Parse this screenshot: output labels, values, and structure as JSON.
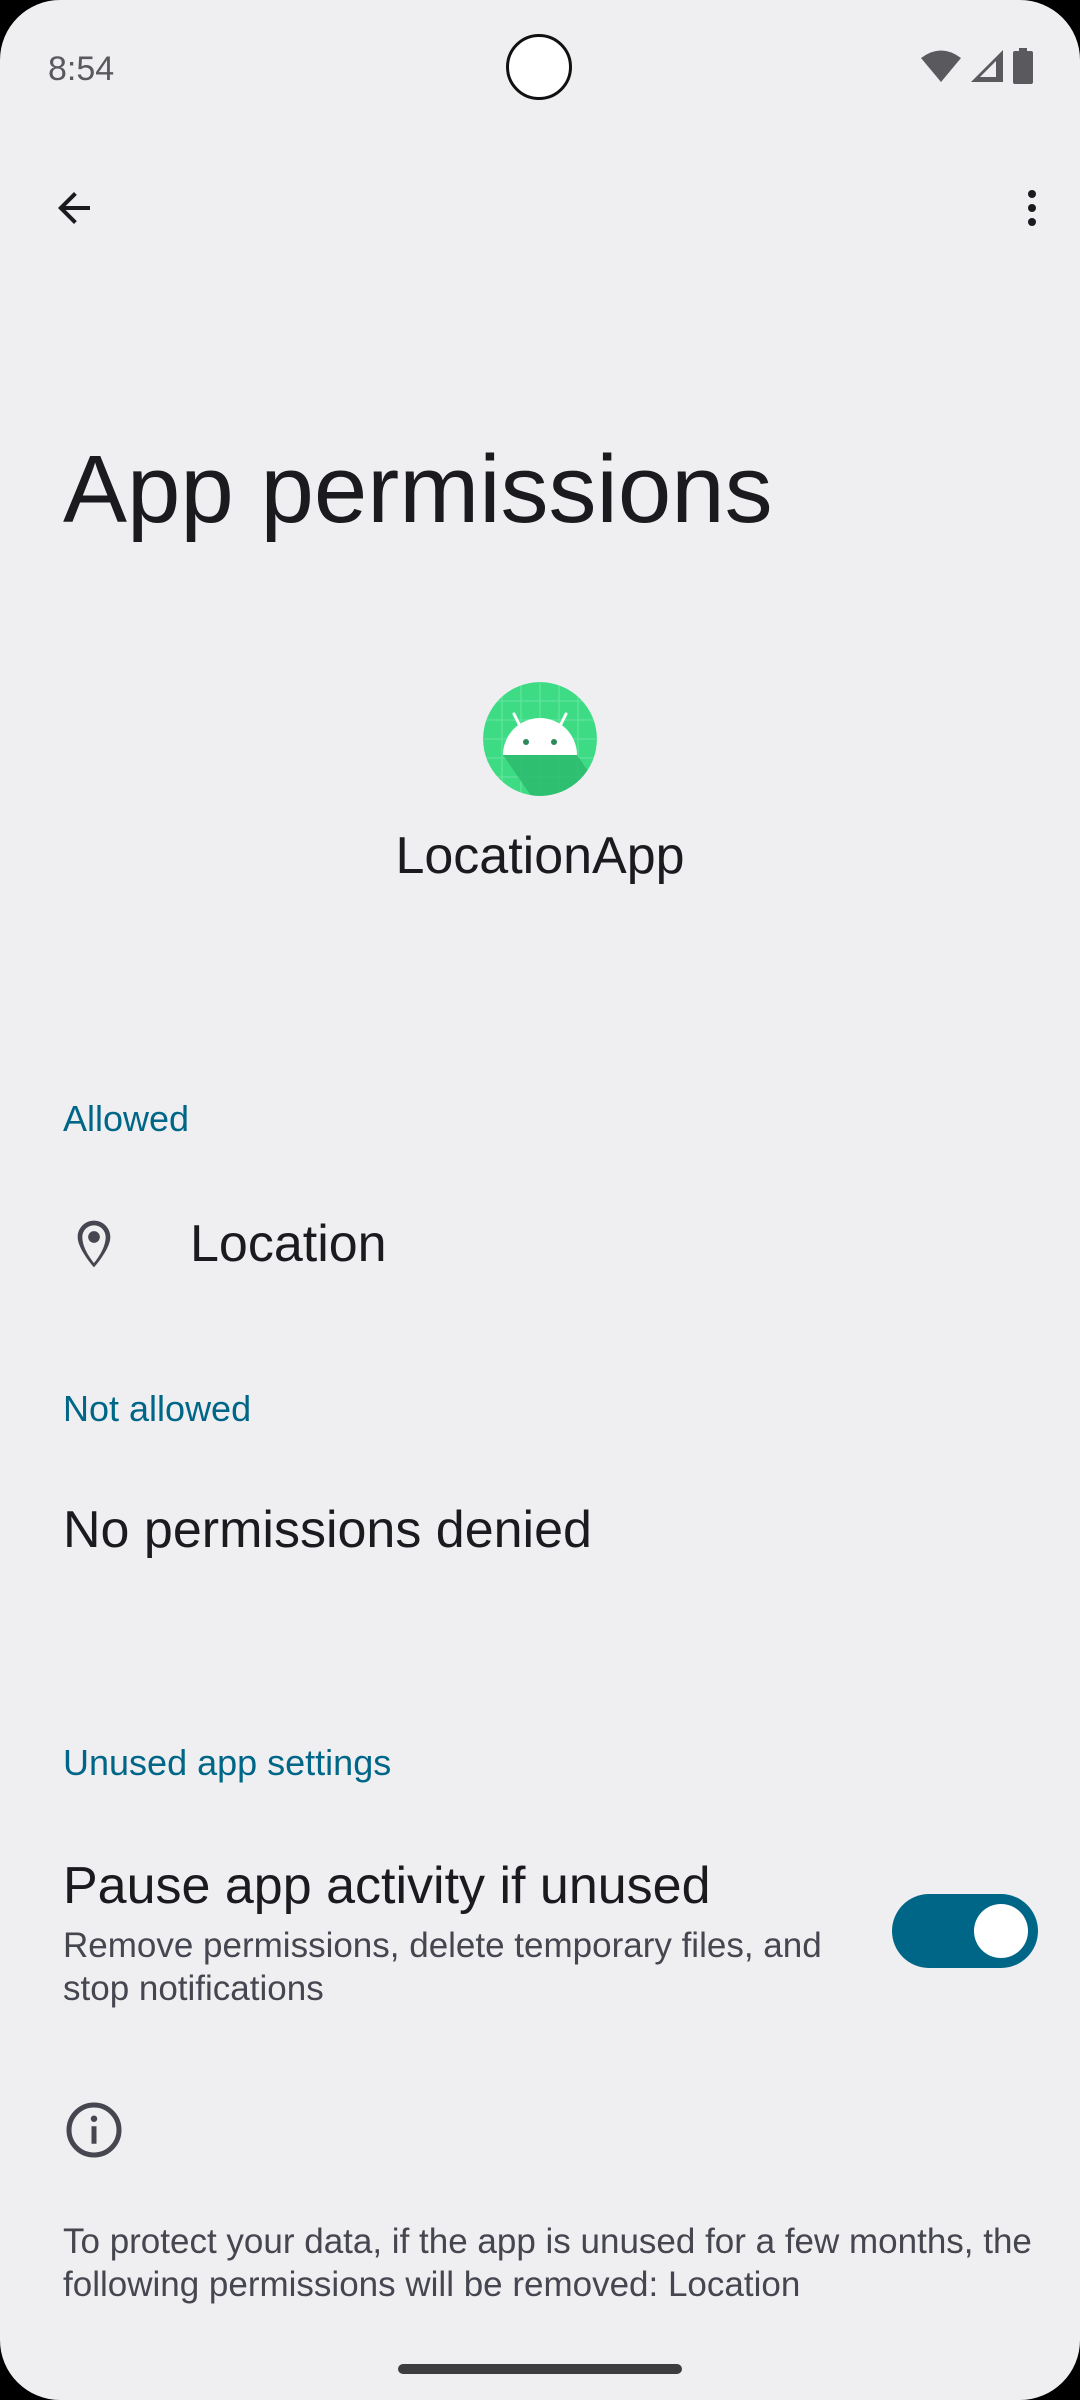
{
  "status_bar": {
    "time": "8:54",
    "icons": [
      "wifi-icon",
      "signal-icon",
      "battery-icon"
    ]
  },
  "toolbar": {
    "back_icon": "arrow-back-icon",
    "more_icon": "more-vert-icon"
  },
  "page": {
    "title": "App permissions",
    "app_name": "LocationApp",
    "app_icon": "android-app-icon"
  },
  "sections": {
    "allowed": {
      "header": "Allowed",
      "items": [
        {
          "label": "Location",
          "icon": "location-pin-icon"
        }
      ]
    },
    "not_allowed": {
      "header": "Not allowed",
      "empty_text": "No permissions denied"
    },
    "unused": {
      "header": "Unused app settings",
      "pause_title": "Pause app activity if unused",
      "pause_summary": "Remove permissions, delete temporary files, and stop notifications",
      "pause_enabled": true
    }
  },
  "footer": {
    "info_icon": "info-icon",
    "text": "To protect your data, if the app is unused for a few months, the following permissions will be removed: Location"
  },
  "colors": {
    "background": "#efeff2",
    "accent": "#006687",
    "app_icon_green": "#3ddc84"
  }
}
